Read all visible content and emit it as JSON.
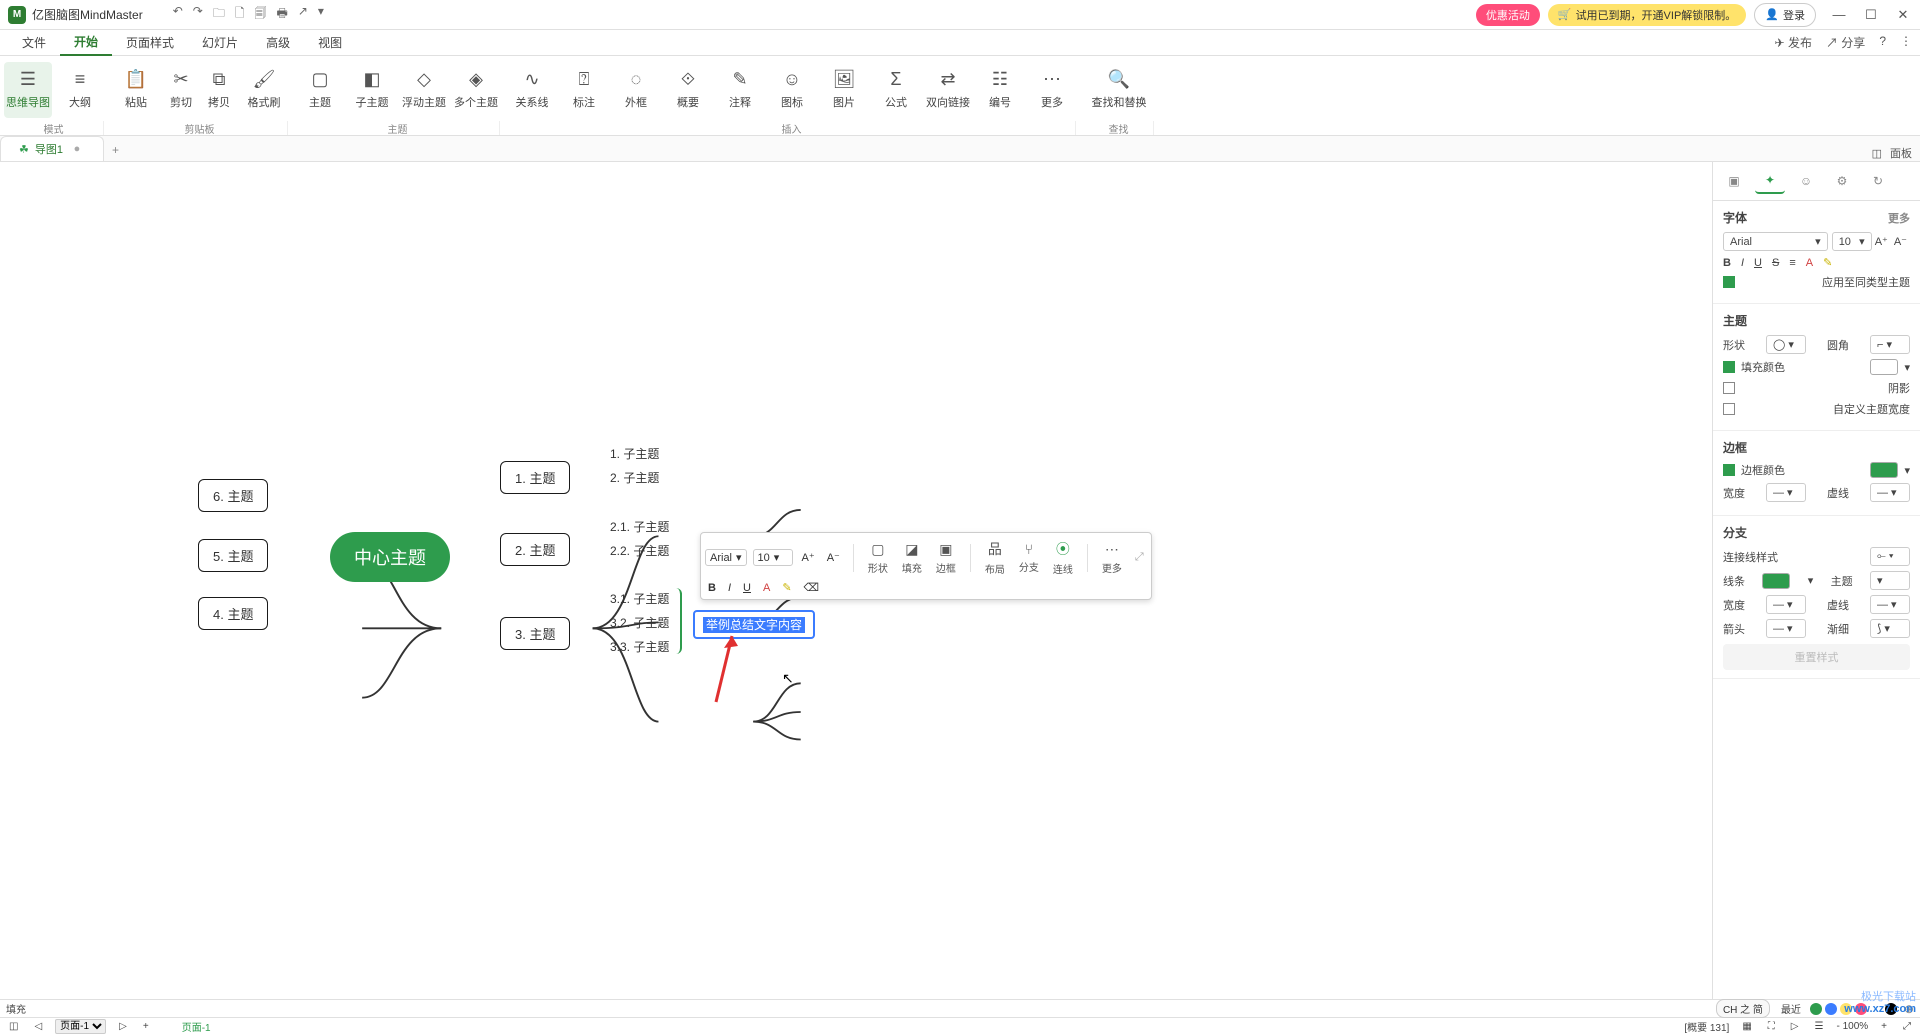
{
  "app": {
    "name": "亿图脑图MindMaster"
  },
  "titlebar_icons": [
    "↶",
    "↷",
    "🗀",
    "🗋",
    "🗐",
    "🖶",
    "↗",
    "▾"
  ],
  "window_controls": {
    "min": "—",
    "max": "☐",
    "close": "✕"
  },
  "header_buttons": {
    "promo": "优惠活动",
    "trial": "试用已到期，开通VIP解锁限制。",
    "login": "登录"
  },
  "menubar": [
    "文件",
    "开始",
    "页面样式",
    "幻灯片",
    "高级",
    "视图"
  ],
  "menubar_active": "开始",
  "menubar_right": {
    "publish": "发布",
    "share": "分享",
    "help": "?"
  },
  "ribbon": {
    "g0": {
      "label": "模式",
      "btns": [
        {
          "id": "mindmap-mode",
          "icon": "☰",
          "text": "思维导图"
        },
        {
          "id": "outline-mode",
          "icon": "≡",
          "text": "大纲"
        }
      ]
    },
    "g1": {
      "label": "剪贴板",
      "btns": [
        {
          "id": "paste",
          "icon": "📋",
          "text": "粘贴"
        },
        {
          "id": "cut",
          "icon": "✂",
          "text": "剪切"
        },
        {
          "id": "copy",
          "icon": "⧉",
          "text": "拷贝"
        },
        {
          "id": "format-painter",
          "icon": "🖌",
          "text": "格式刷"
        }
      ]
    },
    "g2": {
      "label": "主题",
      "btns": [
        {
          "id": "topic",
          "icon": "▢",
          "text": "主题"
        },
        {
          "id": "sub-topic",
          "icon": "◧",
          "text": "子主题"
        },
        {
          "id": "float-topic",
          "icon": "◇",
          "text": "浮动主题"
        },
        {
          "id": "multi-topic",
          "icon": "◈",
          "text": "多个主题"
        }
      ]
    },
    "g3": {
      "label": "插入",
      "btns": [
        {
          "id": "relation",
          "icon": "∿",
          "text": "关系线"
        },
        {
          "id": "callout",
          "icon": "⍰",
          "text": "标注"
        },
        {
          "id": "boundary",
          "icon": "◌",
          "text": "外框"
        },
        {
          "id": "summary",
          "icon": "⟐",
          "text": "概要"
        },
        {
          "id": "annotation",
          "icon": "✎",
          "text": "注释"
        },
        {
          "id": "icon",
          "icon": "☺",
          "text": "图标"
        },
        {
          "id": "picture",
          "icon": "🖼",
          "text": "图片"
        },
        {
          "id": "formula",
          "icon": "Σ",
          "text": "公式"
        },
        {
          "id": "two-way-link",
          "icon": "⇄",
          "text": "双向链接"
        },
        {
          "id": "numbering",
          "icon": "☷",
          "text": "编号"
        },
        {
          "id": "more",
          "icon": "⋯",
          "text": "更多"
        }
      ]
    },
    "g4": {
      "label": "查找",
      "btns": [
        {
          "id": "find-replace",
          "icon": "🔍",
          "text": "查找和替换"
        }
      ]
    }
  },
  "doctab": {
    "name": "导图1",
    "dirty": "●",
    "add": "+"
  },
  "doctabs_right": {
    "toggle": "面板"
  },
  "mindmap": {
    "center": "中心主题",
    "left": [
      "6. 主题",
      "5. 主题",
      "4. 主题"
    ],
    "right": [
      {
        "label": "1. 主题",
        "children": [
          "1. 子主题",
          "2. 子主题"
        ]
      },
      {
        "label": "2. 主题",
        "children": [
          "2.1. 子主题",
          "2.2. 子主题"
        ]
      },
      {
        "label": "3. 主题",
        "children": [
          "3.1. 子主题",
          "3.2. 子主题",
          "3.3. 子主题"
        ]
      }
    ],
    "summary_node": "举例总结文字内容"
  },
  "float_fmt": {
    "font": "Arial",
    "size": "10",
    "row1": {
      "inc": "A⁺",
      "dec": "A⁻"
    },
    "row2": {
      "bold": "B",
      "italic": "I",
      "underline": "U",
      "fontcolor": "A",
      "highlight": "✎",
      "clear": "⌫"
    },
    "blocks": [
      {
        "id": "shape",
        "icon": "▢",
        "label": "形状"
      },
      {
        "id": "fill",
        "icon": "◪",
        "label": "填充"
      },
      {
        "id": "border",
        "icon": "▣",
        "label": "边框"
      },
      {
        "id": "layout",
        "icon": "品",
        "label": "布局"
      },
      {
        "id": "branch",
        "icon": "⑂",
        "label": "分支"
      },
      {
        "id": "connector",
        "icon": "⦿",
        "label": "连线"
      },
      {
        "id": "more",
        "icon": "⋯",
        "label": "更多"
      }
    ],
    "collapse": "⤢"
  },
  "rightpanel": {
    "tabs": [
      {
        "id": "format",
        "icon": "▣"
      },
      {
        "id": "ai",
        "icon": "✦"
      },
      {
        "id": "emoji",
        "icon": "☺"
      },
      {
        "id": "settings",
        "icon": "⚙"
      },
      {
        "id": "history",
        "icon": "↻"
      }
    ],
    "active_tab": "ai",
    "font": {
      "title": "字体",
      "more": "更多",
      "family": "Arial",
      "size": "10",
      "inc": "A⁺",
      "dec": "A⁻",
      "bold": "B",
      "italic": "I",
      "underline": "U",
      "strike": "S",
      "align": "≡",
      "color": "A",
      "highlight": "✎",
      "apply_same": "应用至同类型主题"
    },
    "topic": {
      "title": "主题",
      "shape_label": "形状",
      "corner_label": "圆角",
      "fill": "填充颜色",
      "shadow": "阴影",
      "custom_width": "自定义主题宽度"
    },
    "border": {
      "title": "边框",
      "color": "边框颜色",
      "width": "宽度",
      "dash": "虚线"
    },
    "branch": {
      "title": "分支",
      "connector_style": "连接线样式",
      "line": "线条",
      "topic": "主题",
      "width": "宽度",
      "dash": "虚线",
      "arrow": "箭头",
      "taper": "渐细"
    },
    "reset_btn": "重置样式"
  },
  "palette": {
    "label": "填充",
    "theme": "CH 之 简",
    "recent": "最近"
  },
  "status": {
    "page_selector": "页面-1",
    "add_page": "+",
    "page_tab": "页面-1",
    "summary": "[概要 131]",
    "zoom": "- 100%"
  },
  "watermark": {
    "l1": "极光下载站",
    "l2": "www.xz7.com"
  },
  "palette_colors": [
    "#000000",
    "#3f0000",
    "#7f0000",
    "#bf0000",
    "#ff0000",
    "#ff4040",
    "#ff8080",
    "#ffbfbf",
    "#3f1f00",
    "#7f3f00",
    "#bf5f00",
    "#ff7f00",
    "#ffaa55",
    "#ffd4aa",
    "#3f3f00",
    "#7f7f00",
    "#bfbf00",
    "#ffff00",
    "#ffff80",
    "#1f3f00",
    "#3f7f00",
    "#5fbf00",
    "#7fff00",
    "#bfff80",
    "#003f00",
    "#007f00",
    "#00bf00",
    "#00ff00",
    "#80ff80",
    "#003f1f",
    "#007f3f",
    "#00bf5f",
    "#00ff7f",
    "#80ffbf",
    "#003f3f",
    "#007f7f",
    "#00bfbf",
    "#00ffff",
    "#80ffff",
    "#001f3f",
    "#003f7f",
    "#005fbf",
    "#007fff",
    "#80bfff",
    "#00003f",
    "#00007f",
    "#0000bf",
    "#0000ff",
    "#8080ff",
    "#1f003f",
    "#3f007f",
    "#5f00bf",
    "#7f00ff",
    "#bf80ff",
    "#3f003f",
    "#7f007f",
    "#bf00bf",
    "#ff00ff",
    "#ff80ff",
    "#3f001f",
    "#7f003f",
    "#bf005f",
    "#ff007f",
    "#ff80bf",
    "#1a1a1a",
    "#333333",
    "#4d4d4d",
    "#666666",
    "#808080",
    "#999999",
    "#b3b3b3",
    "#cccccc",
    "#e6e6e6",
    "#ffffff"
  ],
  "recent_colors": [
    "#2e9c4d",
    "#3b7cff",
    "#ffe36b",
    "#ff4d7a",
    "#ffffff",
    "#000000"
  ]
}
